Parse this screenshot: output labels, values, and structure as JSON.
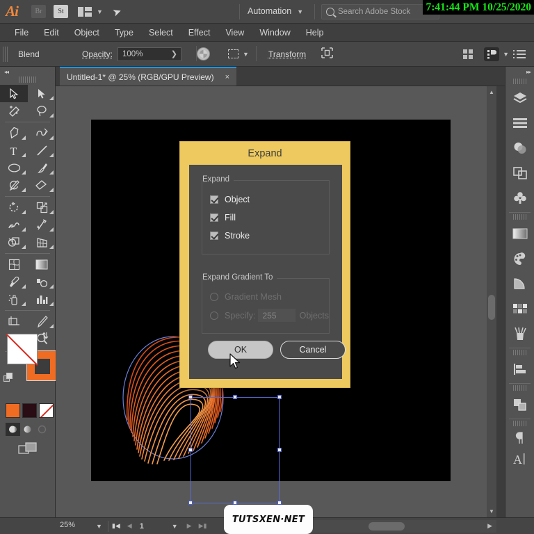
{
  "app": {
    "name": "Adobe Illustrator",
    "logo_text": "Ai",
    "bridge_label": "Br",
    "stock_label": "St",
    "automation_label": "Automation",
    "clock": "7:41:44 PM 10/25/2020",
    "accent_color": "#f0873a"
  },
  "search": {
    "placeholder": "Search Adobe Stock",
    "value": "Search Adobe Stock"
  },
  "menubar": {
    "items": [
      {
        "label": "File"
      },
      {
        "label": "Edit"
      },
      {
        "label": "Object"
      },
      {
        "label": "Type"
      },
      {
        "label": "Select"
      },
      {
        "label": "Effect"
      },
      {
        "label": "View"
      },
      {
        "label": "Window"
      },
      {
        "label": "Help"
      }
    ]
  },
  "optionsbar": {
    "tool_label": "Blend",
    "opacity_label": "Opacity:",
    "opacity_value": "100%",
    "transform_label": "Transform"
  },
  "document": {
    "tab_title": "Untitled-1* @ 25% (RGB/GPU Preview)",
    "close_label": "×"
  },
  "toolbar": {
    "tools": [
      {
        "name": "selection-tool",
        "selected": true
      },
      {
        "name": "direct-selection-tool",
        "selected": false
      },
      {
        "name": "magic-wand-tool",
        "selected": false
      },
      {
        "name": "lasso-tool",
        "selected": false
      },
      {
        "name": "pen-tool",
        "selected": false
      },
      {
        "name": "curvature-tool",
        "selected": false
      },
      {
        "name": "type-tool",
        "selected": false
      },
      {
        "name": "line-segment-tool",
        "selected": false
      },
      {
        "name": "ellipse-tool",
        "selected": false
      },
      {
        "name": "paintbrush-tool",
        "selected": false
      },
      {
        "name": "shaper-tool",
        "selected": false
      },
      {
        "name": "eraser-tool",
        "selected": false
      },
      {
        "name": "rotate-tool",
        "selected": false
      },
      {
        "name": "scale-tool",
        "selected": false
      },
      {
        "name": "width-tool",
        "selected": false
      },
      {
        "name": "free-transform-tool",
        "selected": false
      },
      {
        "name": "shape-builder-tool",
        "selected": false
      },
      {
        "name": "perspective-grid-tool",
        "selected": false
      },
      {
        "name": "mesh-tool",
        "selected": false
      },
      {
        "name": "gradient-tool",
        "selected": false
      },
      {
        "name": "eyedropper-tool",
        "selected": false
      },
      {
        "name": "blend-tool",
        "selected": false
      },
      {
        "name": "symbol-sprayer-tool",
        "selected": false
      },
      {
        "name": "column-graph-tool",
        "selected": false
      },
      {
        "name": "artboard-tool",
        "selected": false
      },
      {
        "name": "slice-tool",
        "selected": false
      },
      {
        "name": "hand-tool",
        "selected": false
      },
      {
        "name": "zoom-tool",
        "selected": false
      }
    ],
    "fill_color": "#ffffff",
    "fill_none": true,
    "stroke_color": "#f06c22",
    "swatch_colors": [
      "#f06c22",
      "#2a0c14",
      "#ffffff"
    ]
  },
  "dialog": {
    "title": "Expand",
    "group_expand_label": "Expand",
    "checkboxes": [
      {
        "label": "Object",
        "checked": true
      },
      {
        "label": "Fill",
        "checked": true
      },
      {
        "label": "Stroke",
        "checked": true
      }
    ],
    "group_gradient_label": "Expand Gradient To",
    "radios": [
      {
        "label": "Gradient Mesh",
        "checked": false,
        "enabled": false
      },
      {
        "label": "Specify:",
        "checked": false,
        "enabled": false
      }
    ],
    "specify_value": "255",
    "objects_label": "Objects",
    "ok_label": "OK",
    "cancel_label": "Cancel",
    "title_bg": "#edc95f"
  },
  "panels": {
    "items": [
      {
        "name": "layers-panel"
      },
      {
        "name": "libraries-panel"
      },
      {
        "name": "transparency-panel"
      },
      {
        "name": "pathfinder-panel"
      },
      {
        "name": "symbols-panel"
      },
      {
        "name": "gradient-panel"
      },
      {
        "name": "color-panel"
      },
      {
        "name": "color-guide-panel"
      },
      {
        "name": "swatches-panel"
      },
      {
        "name": "brushes-panel"
      },
      {
        "name": "align-panel"
      },
      {
        "name": "transform-panel"
      },
      {
        "name": "paragraph-panel"
      },
      {
        "name": "character-panel"
      }
    ]
  },
  "statusbar": {
    "zoom_value": "25%",
    "page_value": "1"
  },
  "watermark": {
    "text": "TUTSXEN·NET"
  }
}
